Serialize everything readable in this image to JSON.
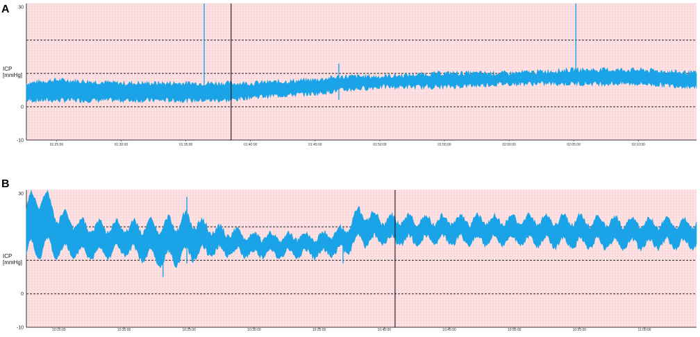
{
  "chart_data": [
    {
      "type": "line",
      "panel_label": "A",
      "ylabel_lines": [
        "ICP",
        "[mmHg]"
      ],
      "ylim": [
        -10,
        31
      ],
      "y_ticks": [
        "30",
        "0",
        "-10"
      ],
      "reference_lines": [
        0,
        10,
        20
      ],
      "x_ticks": [
        "01:25:00",
        "01:30:00",
        "01:35:00",
        "01:40:00",
        "01:45:00",
        "01:50:00",
        "01:55:00",
        "02:00:00",
        "02:05:00",
        "02:10:00"
      ],
      "cursor_time": "01:38:30",
      "series": [
        {
          "color": "#1aa3e6",
          "x": [
            "01:22:40",
            "01:25:00",
            "01:30:00",
            "01:35:00",
            "01:38:30",
            "01:40:00",
            "01:45:00",
            "01:47:00",
            "01:50:00",
            "01:55:00",
            "02:00:00",
            "02:05:00",
            "02:10:00",
            "02:14:30"
          ],
          "lower": [
            2,
            2,
            2,
            2,
            2,
            3,
            4,
            5,
            6,
            6,
            7,
            7,
            7,
            6
          ],
          "upper": [
            7,
            8,
            7,
            7,
            7,
            7,
            8,
            9,
            9,
            10,
            10,
            11,
            11,
            10
          ],
          "spikes": [
            {
              "x": "01:36:25",
              "top": 31,
              "bottom": 6
            },
            {
              "x": "02:05:10",
              "top": 31,
              "bottom": 10
            },
            {
              "x": "01:46:50",
              "top": 13,
              "bottom": 2
            }
          ]
        }
      ]
    },
    {
      "type": "line",
      "panel_label": "B",
      "ylabel_lines": [
        "ICP",
        "[mmHg]"
      ],
      "ylim": [
        -10,
        31
      ],
      "y_ticks": [
        "30",
        "0",
        "-10"
      ],
      "reference_lines": [
        0,
        10,
        20
      ],
      "x_ticks": [
        "10:15:00",
        "10:20:00",
        "10:25:00",
        "10:30:00",
        "10:35:00",
        "10:40:00",
        "10:45:00",
        "10:50:00",
        "10:55:00",
        "11:00:00"
      ],
      "cursor_time": "10:40:50",
      "series": [
        {
          "color": "#1aa3e6",
          "x": [
            "10:12:30",
            "10:13:30",
            "10:15:00",
            "10:17:00",
            "10:20:00",
            "10:23:00",
            "10:25:00",
            "10:27:00",
            "10:30:00",
            "10:35:00",
            "10:37:00",
            "10:38:00",
            "10:40:00",
            "10:45:00",
            "10:50:00",
            "10:55:00",
            "11:00:00",
            "11:04:00"
          ],
          "lower": [
            12,
            14,
            13,
            12,
            13,
            10,
            12,
            13,
            12,
            12,
            13,
            16,
            16,
            16,
            16,
            15,
            15,
            15
          ],
          "upper": [
            25,
            30,
            23,
            20,
            20,
            20,
            22,
            19,
            17,
            17,
            19,
            24,
            22,
            22,
            22,
            22,
            21,
            21
          ],
          "spikes": [
            {
              "x": "10:23:00",
              "top": 19,
              "bottom": 5
            },
            {
              "x": "10:24:50",
              "top": 29,
              "bottom": 9
            },
            {
              "x": "10:36:50",
              "top": 16,
              "bottom": 9
            }
          ]
        }
      ]
    }
  ],
  "colors": {
    "grid_background": "#fde6e8",
    "grid_minor": "#f6c2c6",
    "trace": "#1aa3e6",
    "cursor": "#000000"
  }
}
